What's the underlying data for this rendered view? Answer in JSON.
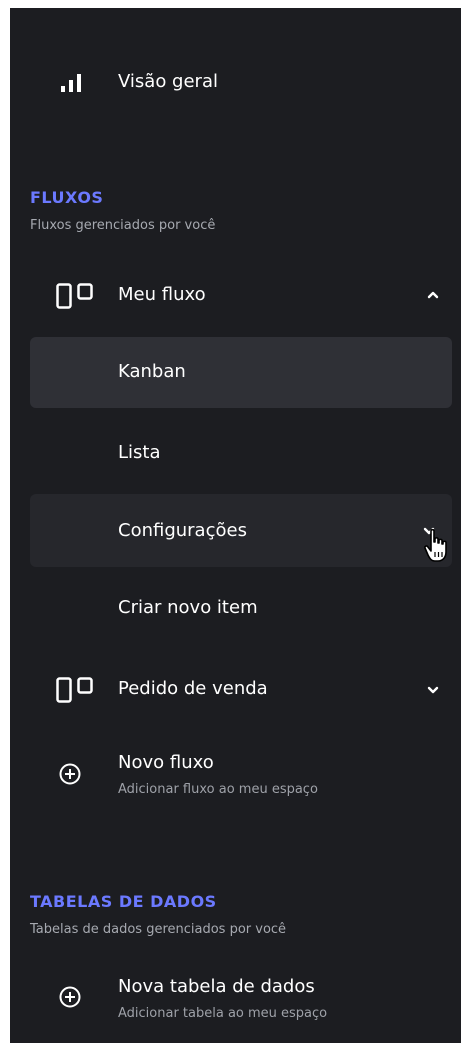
{
  "nav": {
    "overview_label": "Visão geral",
    "flows_section": {
      "title": "FLUXOS",
      "subtitle": "Fluxos gerenciados por você"
    },
    "flow_items": [
      {
        "label": "Meu fluxo",
        "expanded": true,
        "children": [
          {
            "label": "Kanban",
            "selected": true
          },
          {
            "label": "Lista"
          },
          {
            "label": "Configurações",
            "hovered": true,
            "expanded": false
          },
          {
            "label": "Criar novo item"
          }
        ]
      },
      {
        "label": "Pedido de venda",
        "expanded": false
      }
    ],
    "new_flow": {
      "label": "Novo fluxo",
      "subtitle": "Adicionar fluxo ao meu espaço"
    },
    "tables_section": {
      "title": "TABELAS DE DADOS",
      "subtitle": "Tabelas de dados gerenciados por você"
    },
    "new_table": {
      "label": "Nova tabela de dados",
      "subtitle": "Adicionar tabela ao meu espaço"
    }
  },
  "icons": {
    "overview": "bar-chart-icon",
    "flow": "kanban-board-icon",
    "add": "plus-circle-icon",
    "expand": "chevron-up-icon",
    "collapse": "chevron-down-icon",
    "cursor": "hand-pointer-cursor"
  },
  "colors": {
    "panel_bg": "#1c1d21",
    "selected_bg": "#2f3036",
    "hover_bg": "#26272c",
    "section_accent": "#6b79ff",
    "text": "#ffffff",
    "muted_text": "#9ea1a8"
  }
}
